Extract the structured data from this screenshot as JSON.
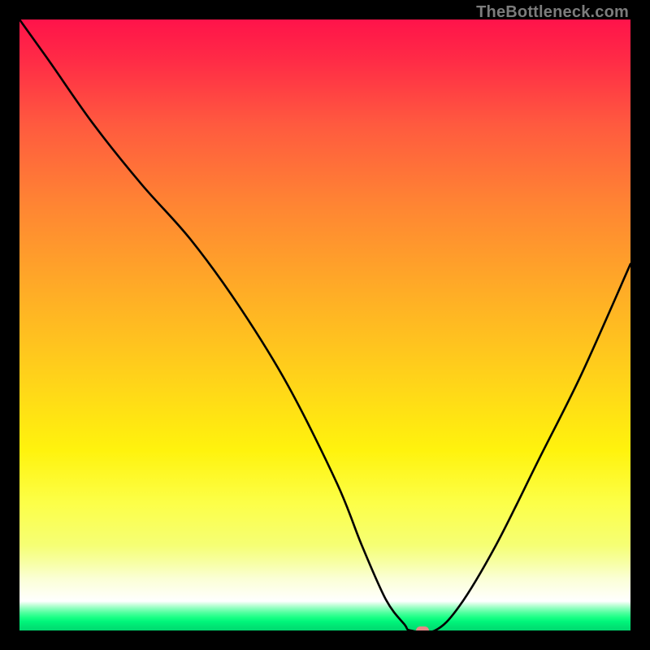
{
  "watermark": "TheBottleneck.com",
  "chart_data": {
    "type": "line",
    "title": "",
    "xlabel": "",
    "ylabel": "",
    "xlim": [
      0,
      100
    ],
    "ylim": [
      0,
      100
    ],
    "x": [
      0,
      5,
      12,
      20,
      28,
      36,
      44,
      52,
      56,
      60,
      63,
      64,
      68,
      72,
      78,
      85,
      92,
      100
    ],
    "values": [
      100,
      93,
      83,
      73,
      64,
      53,
      40,
      24,
      14,
      5,
      1,
      0,
      0,
      4,
      14,
      28,
      42,
      60
    ],
    "background": {
      "gradient_top": "#ff134a",
      "gradient_mid": "#fff30d",
      "gradient_bottom_green": "#00e574"
    },
    "marker": {
      "x": 66,
      "y": 0,
      "color": "#e88787"
    }
  }
}
